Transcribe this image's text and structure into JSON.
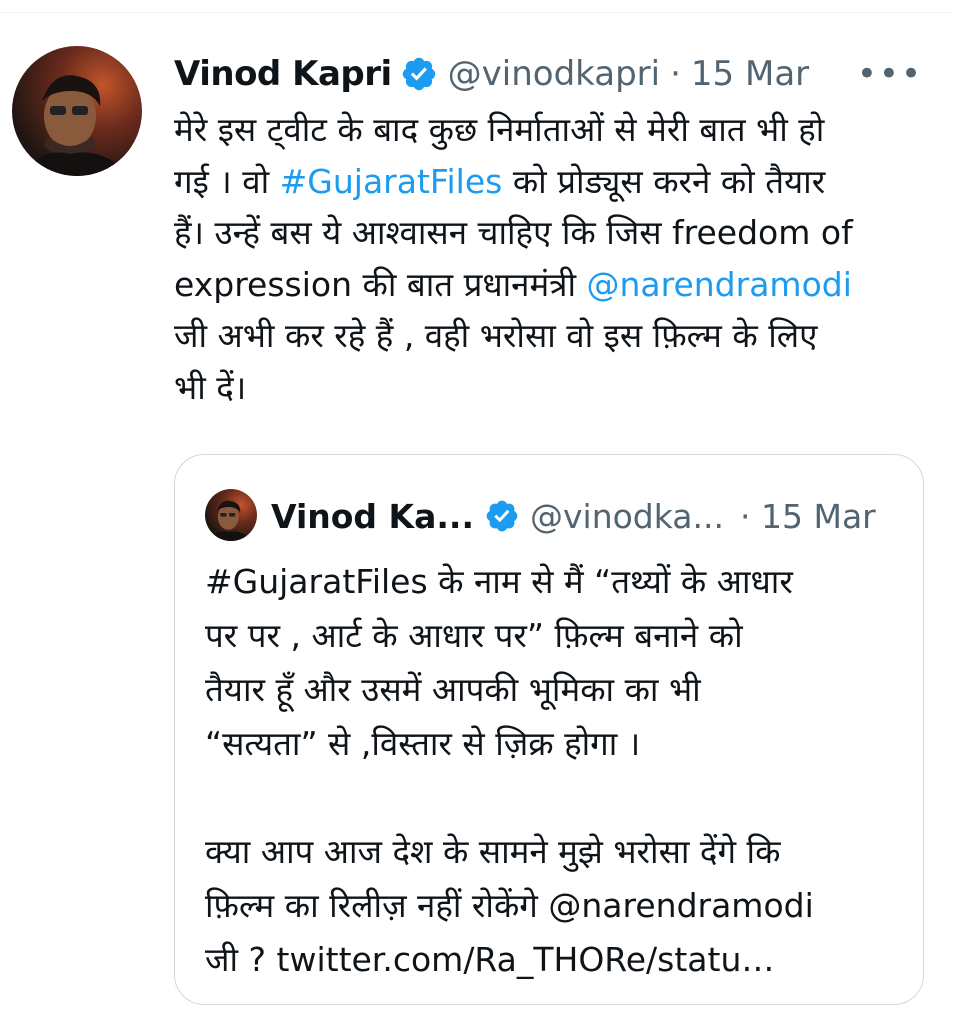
{
  "tweet": {
    "author_name": "Vinod Kapri",
    "handle": "@vinodkapri",
    "separator": "·",
    "date": "15 Mar",
    "more_label": "•••",
    "text_lines": [
      [
        "मेरे इस ट्वीट के बाद  कुछ निर्माताओं से मेरी बात भी हो"
      ],
      [
        "गई । वो ",
        "#GujaratFiles",
        " को प्रोड्यूस करने को तैयार"
      ],
      [
        "हैं। उन्हें बस ये आश्वासन चाहिए कि जिस freedom of"
      ],
      [
        "expression की बात प्रधानमंत्री ",
        "@narendramodi"
      ],
      [
        "जी अभी कर रहे हैं , वही भरोसा वो इस फ़िल्म के लिए"
      ],
      [
        "भी दें।"
      ]
    ]
  },
  "quoted_tweet": {
    "author_name": "Vinod Ka...",
    "handle": "@vinodka...",
    "separator": "·",
    "date": "15 Mar",
    "lines": [
      "#GujaratFiles के नाम से मैं “तथ्यों के आधार",
      "पर पर , आर्ट के आधार पर” फ़िल्म बनाने को",
      "तैयार हूँ और उसमें आपकी भूमिका का भी",
      "“सत्यता” से ,विस्तार से ज़िक्र होगा ।",
      "क्या आप आज देश के सामने मुझे भरोसा देंगे कि",
      "फ़िल्म का रिलीज़ नहीं रोकेंगे @narendramodi",
      "जी ? twitter.com/Ra_THORe/statu…"
    ]
  },
  "colors": {
    "link": "#1d9bf0",
    "secondary_text": "#536471",
    "border": "#cfd9de",
    "verified_badge": "#1d9bf0"
  },
  "icons": {
    "verified": "verified-badge-icon",
    "more": "more-options-icon"
  }
}
